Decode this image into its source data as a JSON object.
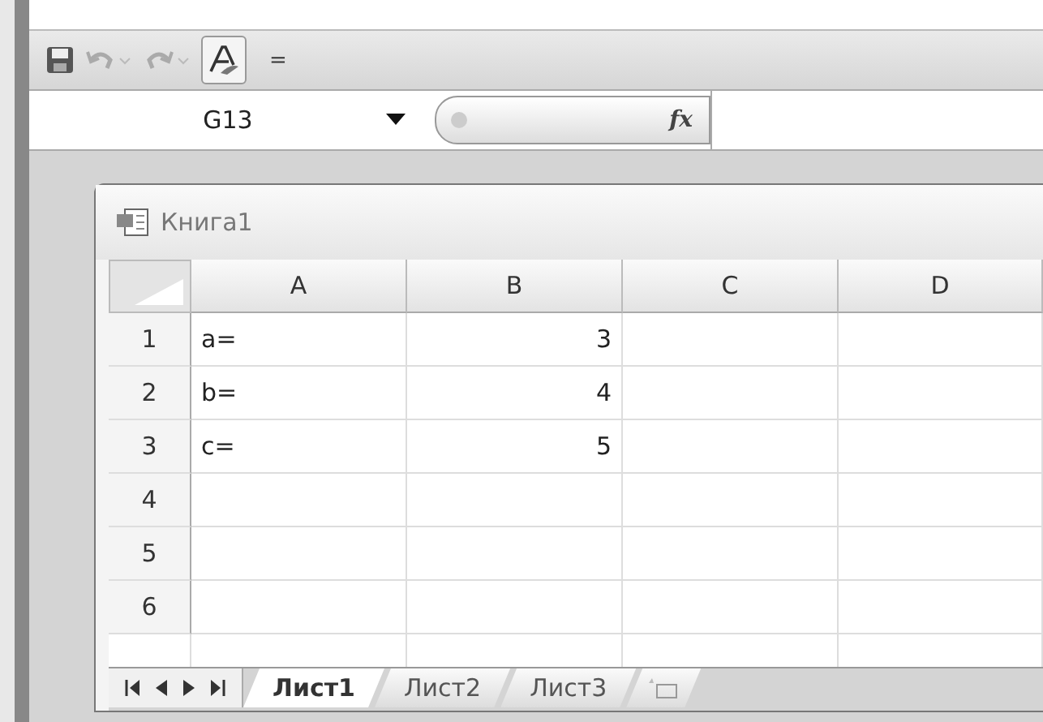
{
  "quick_access": {
    "more": "="
  },
  "formula_bar": {
    "name_box": "G13",
    "fx": "fx"
  },
  "workbook": {
    "title": "Книга1",
    "columns": [
      "A",
      "B",
      "C",
      "D"
    ],
    "rows": [
      {
        "header": "1",
        "cells": [
          "a=",
          "3",
          "",
          ""
        ]
      },
      {
        "header": "2",
        "cells": [
          "b=",
          "4",
          "",
          ""
        ]
      },
      {
        "header": "3",
        "cells": [
          "c=",
          "5",
          "",
          ""
        ]
      },
      {
        "header": "4",
        "cells": [
          "",
          "",
          "",
          ""
        ]
      },
      {
        "header": "5",
        "cells": [
          "",
          "",
          "",
          ""
        ]
      },
      {
        "header": "6",
        "cells": [
          "",
          "",
          "",
          ""
        ]
      }
    ],
    "sheets": [
      {
        "label": "Лист1",
        "selected": true
      },
      {
        "label": "Лист2",
        "selected": false
      },
      {
        "label": "Лист3",
        "selected": false
      }
    ]
  }
}
